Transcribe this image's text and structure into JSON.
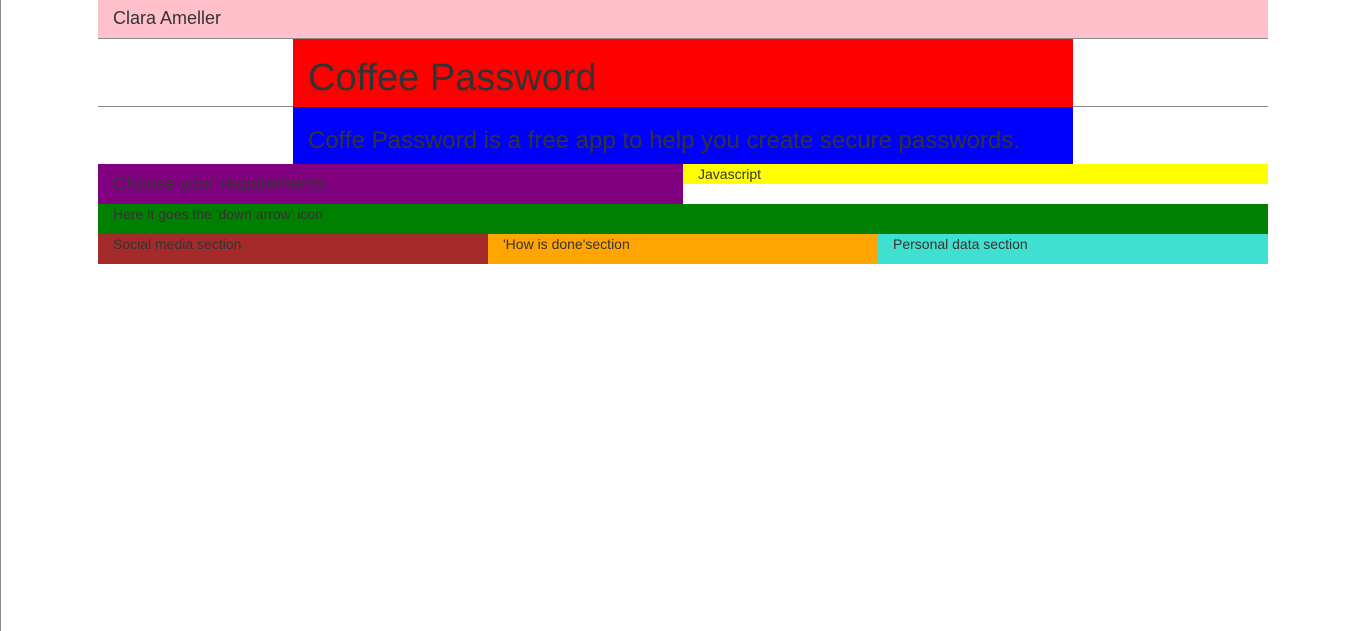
{
  "header": {
    "author": "Clara Ameller"
  },
  "title": {
    "text": "Coffee Password"
  },
  "description": {
    "text": "Coffe Password is a free app to help you create secure passwords."
  },
  "requirements": {
    "text": "Choose your requirements:"
  },
  "javascript": {
    "text": "Javascript"
  },
  "arrow_placeholder": {
    "text": "Here it goes the 'down arrow' icon"
  },
  "sections": [
    {
      "text": "Social media section"
    },
    {
      "text": "'How is done'section"
    },
    {
      "text": "Personal data section"
    }
  ],
  "colors": {
    "header": "#ffc0cb",
    "title": "#ff0000",
    "description": "#0000ff",
    "requirements": "#800080",
    "javascript": "#ffff00",
    "arrow": "#008000",
    "social": "#a52a2a",
    "how": "#ffa500",
    "personal": "#40e0d0"
  }
}
